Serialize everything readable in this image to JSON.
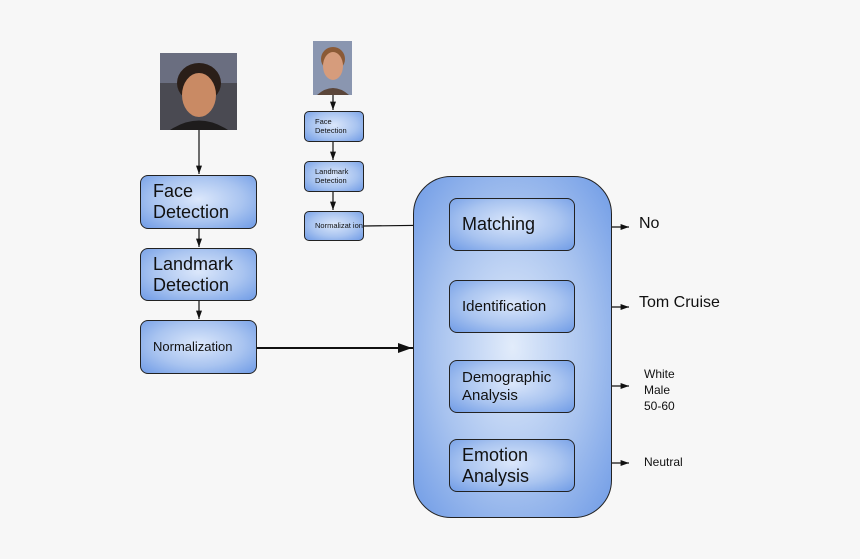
{
  "left_pipeline": {
    "face_detection": "Face Detection",
    "landmark_detection": "Landmark Detection",
    "normalization": "Normalization"
  },
  "right_pipeline": {
    "face_detection": "Face Detection",
    "landmark_detection": "Landmark Detection",
    "normalization": "Normalizat ion"
  },
  "modules": {
    "matching": "Matching",
    "identification": "Identification",
    "demographic": "Demographic Analysis",
    "emotion": "Emotion Analysis"
  },
  "outputs": {
    "matching": "No",
    "identification": "Tom Cruise",
    "demographic": [
      "White",
      "Male",
      "50-60"
    ],
    "emotion": "Neutral"
  },
  "colors": {
    "box_fill": "#a9c4f0",
    "box_edge": "#6f9be6",
    "line": "#111111",
    "background": "#f7f7f7"
  }
}
